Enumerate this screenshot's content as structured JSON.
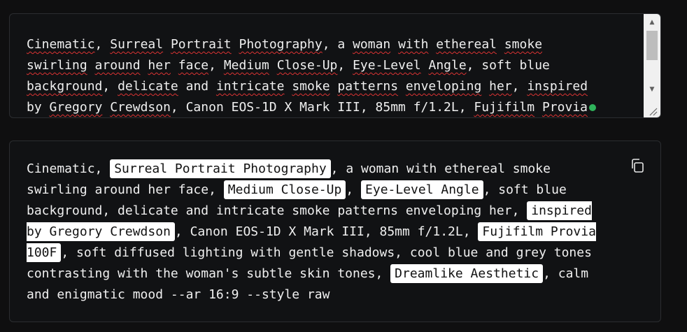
{
  "editor": {
    "lines": [
      [
        {
          "t": "Cinematic",
          "sq": true
        },
        {
          "t": ", "
        },
        {
          "t": "Surreal",
          "sq": true
        },
        {
          "t": " "
        },
        {
          "t": "Portrait",
          "sq": true
        },
        {
          "t": " "
        },
        {
          "t": "Photography",
          "sq": true
        },
        {
          "t": ", a "
        },
        {
          "t": "woman",
          "sq": true
        },
        {
          "t": " "
        },
        {
          "t": "with",
          "sq": true
        },
        {
          "t": " "
        },
        {
          "t": "ethereal",
          "sq": true
        },
        {
          "t": " "
        },
        {
          "t": "smoke",
          "sq": true
        }
      ],
      [
        {
          "t": "swirling",
          "sq": true
        },
        {
          "t": " "
        },
        {
          "t": "around",
          "sq": true
        },
        {
          "t": " "
        },
        {
          "t": "her",
          "sq": true
        },
        {
          "t": " "
        },
        {
          "t": "face",
          "sq": true
        },
        {
          "t": ", "
        },
        {
          "t": "Medium",
          "sq": true
        },
        {
          "t": " "
        },
        {
          "t": "Close-Up",
          "sq": true
        },
        {
          "t": ", "
        },
        {
          "t": "Eye-Level",
          "sq": true
        },
        {
          "t": " "
        },
        {
          "t": "Angle",
          "sq": true
        },
        {
          "t": ", soft blue"
        }
      ],
      [
        {
          "t": "background",
          "sq": true
        },
        {
          "t": ", "
        },
        {
          "t": "delicate",
          "sq": true
        },
        {
          "t": " and "
        },
        {
          "t": "intricate",
          "sq": true
        },
        {
          "t": " "
        },
        {
          "t": "smoke",
          "sq": true
        },
        {
          "t": " "
        },
        {
          "t": "patterns",
          "sq": true
        },
        {
          "t": " "
        },
        {
          "t": "enveloping",
          "sq": true
        },
        {
          "t": " "
        },
        {
          "t": "her",
          "sq": true
        },
        {
          "t": ", "
        },
        {
          "t": "inspired",
          "sq": true
        }
      ],
      [
        {
          "t": "by "
        },
        {
          "t": "Gregory",
          "sq": true
        },
        {
          "t": " "
        },
        {
          "t": "Crewdson",
          "sq": true
        },
        {
          "t": ", Canon EOS-1D X Mark III, 85mm f/1.2L, "
        },
        {
          "t": "Fujifilm",
          "sq": true
        },
        {
          "t": " "
        },
        {
          "t": "Provia",
          "sq": true
        }
      ]
    ]
  },
  "output": {
    "segments": [
      {
        "t": "Cinematic, "
      },
      {
        "t": "Surreal Portrait Photography",
        "tag": true
      },
      {
        "t": ", a woman with ethereal smoke\nswirling around her face, "
      },
      {
        "t": "Medium Close-Up",
        "tag": true
      },
      {
        "t": ", "
      },
      {
        "t": "Eye-Level Angle",
        "tag": true
      },
      {
        "t": ", soft blue\nbackground, delicate and intricate smoke patterns enveloping her, "
      },
      {
        "t": "inspired\nby Gregory Crewdson",
        "tag": true
      },
      {
        "t": ", Canon EOS-1D X Mark III, 85mm f/1.2L, "
      },
      {
        "t": "Fujifilm Provia\n100F",
        "tag": true
      },
      {
        "t": ", soft diffused lighting with gentle shadows, cool blue and grey tones\ncontrasting with the woman's subtle skin tones, "
      },
      {
        "t": "Dreamlike Aesthetic",
        "tag": true
      },
      {
        "t": ", calm\nand enigmatic mood --ar 16:9 --style raw"
      }
    ]
  },
  "icons": {
    "copy": "copy-icon",
    "status": "green-status-dot"
  },
  "colors": {
    "background": "#0f0f10",
    "tag_bg": "#ffffff",
    "status_dot": "#2fb35b",
    "squiggle": "#dd3333"
  }
}
